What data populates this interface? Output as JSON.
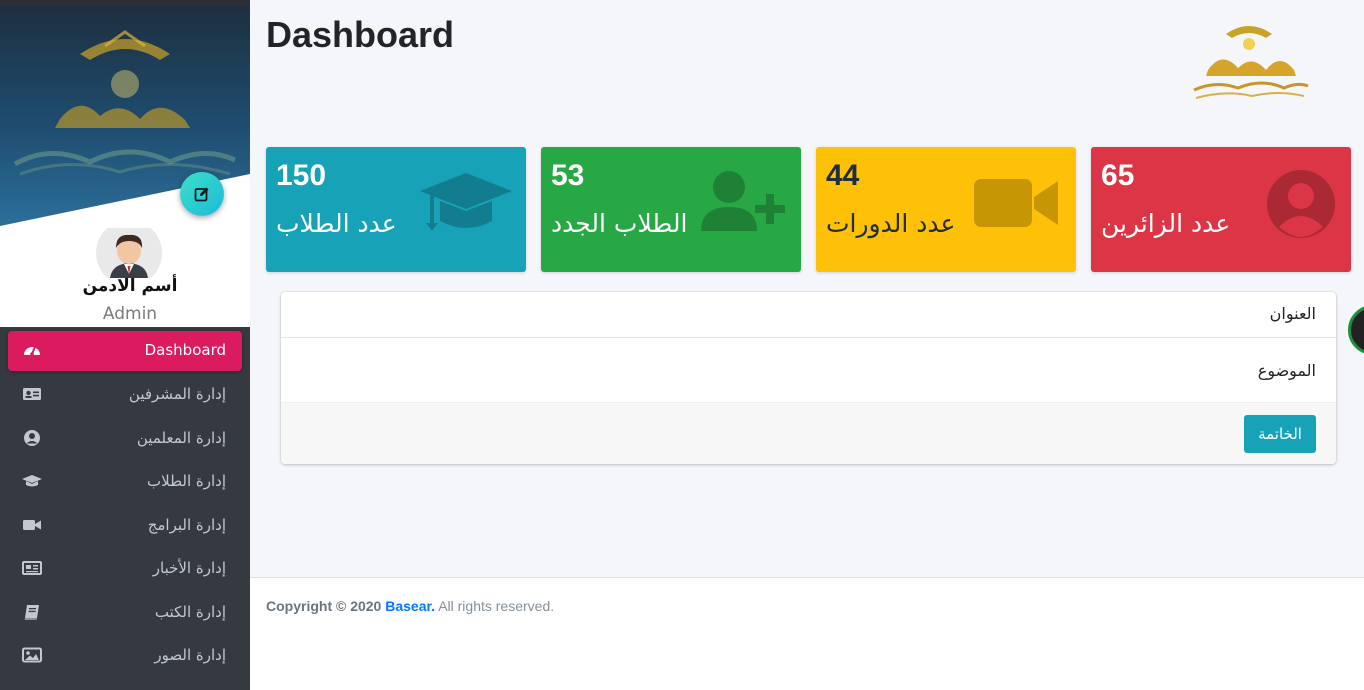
{
  "sidebar": {
    "profile": {
      "name": "أسم الادمن",
      "role": "Admin"
    },
    "nav": [
      {
        "label": "Dashboard",
        "icon": "tachometer-icon",
        "active": true
      },
      {
        "label": "إدارة المشرفين",
        "icon": "id-card-icon",
        "active": false
      },
      {
        "label": "إدارة المعلمين",
        "icon": "user-circle-icon",
        "active": false
      },
      {
        "label": "إدارة الطلاب",
        "icon": "graduation-cap-icon",
        "active": false
      },
      {
        "label": "إدارة البرامج",
        "icon": "video-icon",
        "active": false
      },
      {
        "label": "إدارة الأخبار",
        "icon": "newspaper-icon",
        "active": false
      },
      {
        "label": "إدارة الكتب",
        "icon": "book-icon",
        "active": false
      },
      {
        "label": "إدارة الصور",
        "icon": "image-icon",
        "active": false
      }
    ]
  },
  "header": {
    "title": "Dashboard"
  },
  "stats": [
    {
      "value": "150",
      "label": "عدد الطلاب",
      "color": "#17a2b8",
      "icon": "graduation-cap-icon"
    },
    {
      "value": "53",
      "label": "الطلاب الجدد",
      "color": "#28a745",
      "icon": "user-plus-icon"
    },
    {
      "value": "44",
      "label": "عدد الدورات",
      "color": "#ffc107",
      "icon": "video-icon"
    },
    {
      "value": "65",
      "label": "عدد الزائرين",
      "color": "#dc3545",
      "icon": "user-circle-icon"
    }
  ],
  "card": {
    "title": "العنوان",
    "body": "الموضوع",
    "footer_button": "الخاتمة"
  },
  "footer": {
    "prefix": "Copyright © 2020",
    "brand": "Basear.",
    "suffix": "All rights reserved."
  },
  "colors": {
    "sidebar_bg": "#343a40",
    "active_nav": "#dc1a5f",
    "accent": "#17a2b8"
  }
}
